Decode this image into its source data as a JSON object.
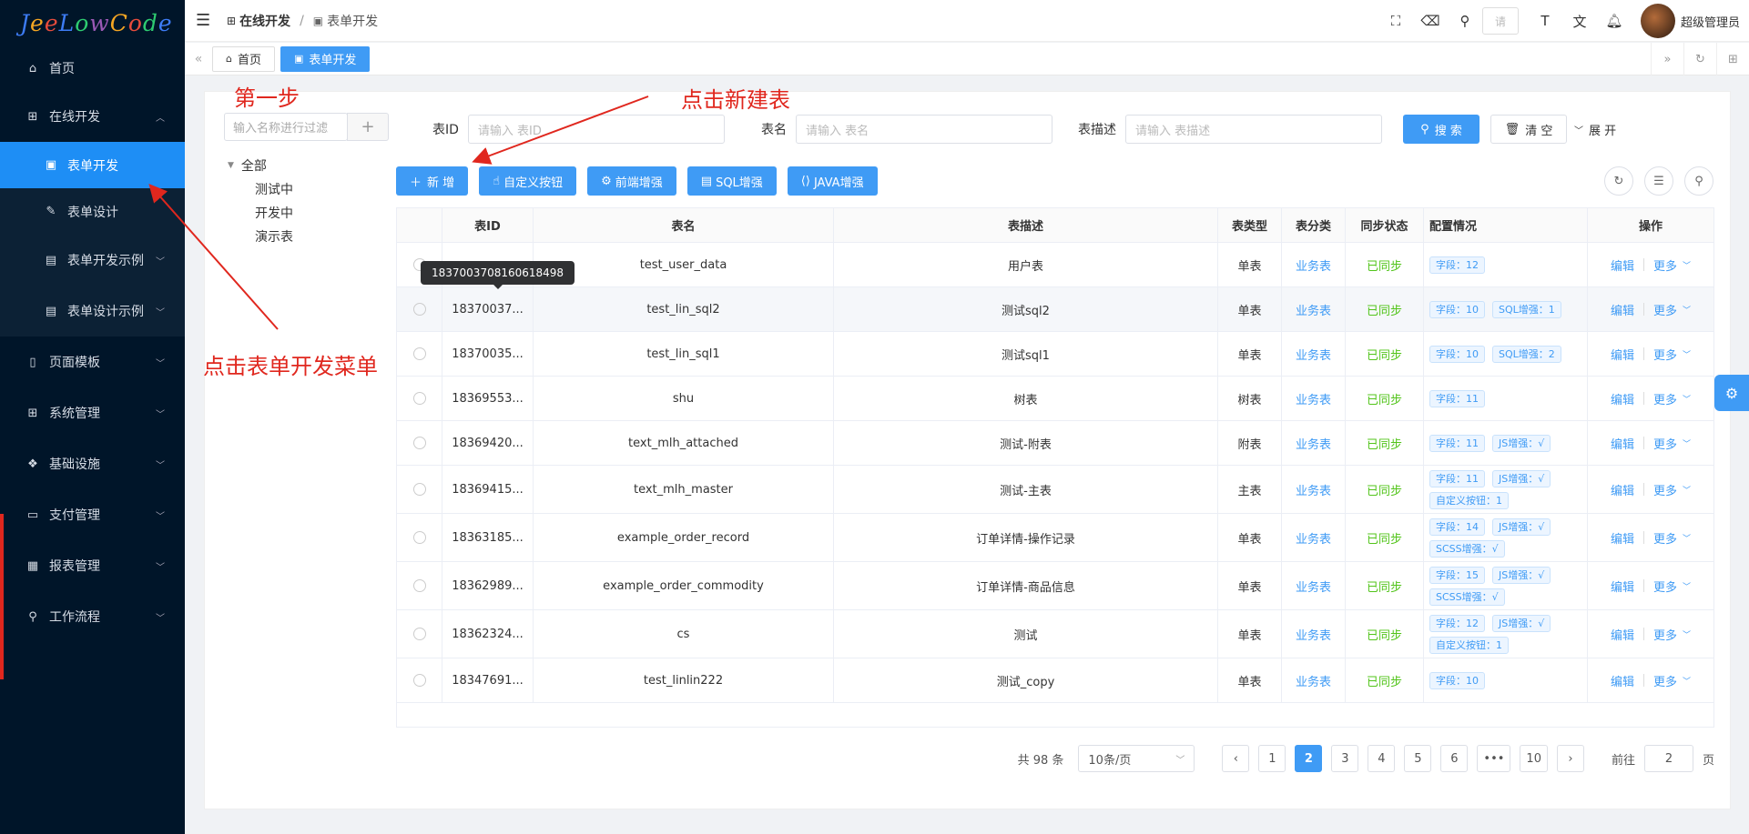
{
  "logo": {
    "text": "JeeLowCode"
  },
  "sidebar": {
    "items": [
      {
        "label": "首页",
        "icon": "home-icon"
      },
      {
        "label": "在线开发",
        "icon": "sitemap-icon",
        "expanded": true
      },
      {
        "label": "页面模板",
        "icon": "tablet-icon"
      },
      {
        "label": "系统管理",
        "icon": "grid-icon"
      },
      {
        "label": "基础设施",
        "icon": "cubes-icon"
      },
      {
        "label": "支付管理",
        "icon": "wallet-icon"
      },
      {
        "label": "报表管理",
        "icon": "report-icon"
      },
      {
        "label": "工作流程",
        "icon": "flow-icon"
      }
    ],
    "sub_items": [
      {
        "label": "表单开发",
        "active": true
      },
      {
        "label": "表单设计"
      },
      {
        "label": "表单开发示例"
      },
      {
        "label": "表单设计示例"
      }
    ]
  },
  "header": {
    "breadcrumb": [
      "在线开发",
      "/",
      "表单开发"
    ],
    "search_placeholder": "请",
    "username": "超级管理员"
  },
  "tabs": [
    {
      "label": "首页"
    },
    {
      "label": "表单开发",
      "active": true
    }
  ],
  "annotations": {
    "step": "第一步",
    "click_new": "点击新建表",
    "click_menu": "点击表单开发菜单"
  },
  "tree": {
    "search_placeholder": "输入名称进行过滤",
    "root": "全部",
    "children": [
      "测试中",
      "开发中",
      "演示表"
    ]
  },
  "filters": {
    "table_id_label": "表ID",
    "table_id_placeholder": "请输入 表ID",
    "table_name_label": "表名",
    "table_name_placeholder": "请输入 表名",
    "table_desc_label": "表描述",
    "table_desc_placeholder": "请输入 表描述",
    "search_btn": "搜 索",
    "clear_btn": "清 空",
    "expand_btn": "展 开"
  },
  "toolbar": {
    "add": "新 增",
    "custom_btn": "自定义按钮",
    "frontend": "前端增强",
    "sql": "SQL增强",
    "java": "JAVA增强"
  },
  "table": {
    "headers": [
      "表ID",
      "表名",
      "表描述",
      "表类型",
      "表分类",
      "同步状态",
      "配置情况",
      "操作"
    ],
    "tooltip": "1837003708160618498",
    "op_edit": "编辑",
    "op_more": "更多",
    "rows": [
      {
        "id": "",
        "name": "test_user_data",
        "desc": "用户表",
        "type": "单表",
        "category": "业务表",
        "sync": "已同步",
        "tags": [
          "字段：12"
        ]
      },
      {
        "id": "18370037...",
        "name": "test_lin_sql2",
        "desc": "测试sql2",
        "type": "单表",
        "category": "业务表",
        "sync": "已同步",
        "tags": [
          "字段：10",
          "SQL增强：1"
        ]
      },
      {
        "id": "18370035...",
        "name": "test_lin_sql1",
        "desc": "测试sql1",
        "type": "单表",
        "category": "业务表",
        "sync": "已同步",
        "tags": [
          "字段：10",
          "SQL增强：2"
        ]
      },
      {
        "id": "18369553...",
        "name": "shu",
        "desc": "树表",
        "type": "树表",
        "category": "业务表",
        "sync": "已同步",
        "tags": [
          "字段：11"
        ]
      },
      {
        "id": "18369420...",
        "name": "text_mlh_attached",
        "desc": "测试-附表",
        "type": "附表",
        "category": "业务表",
        "sync": "已同步",
        "tags": [
          "字段：11",
          "JS增强：√"
        ]
      },
      {
        "id": "18369415...",
        "name": "text_mlh_master",
        "desc": "测试-主表",
        "type": "主表",
        "category": "业务表",
        "sync": "已同步",
        "tags": [
          "字段：11",
          "JS增强：√",
          "自定义按钮：1"
        ]
      },
      {
        "id": "18363185...",
        "name": "example_order_record",
        "desc": "订单详情-操作记录",
        "type": "单表",
        "category": "业务表",
        "sync": "已同步",
        "tags": [
          "字段：14",
          "JS增强：√",
          "SCSS增强：√"
        ]
      },
      {
        "id": "18362989...",
        "name": "example_order_commodity",
        "desc": "订单详情-商品信息",
        "type": "单表",
        "category": "业务表",
        "sync": "已同步",
        "tags": [
          "字段：15",
          "JS增强：√",
          "SCSS增强：√"
        ]
      },
      {
        "id": "18362324...",
        "name": "cs",
        "desc": "测试",
        "type": "单表",
        "category": "业务表",
        "sync": "已同步",
        "tags": [
          "字段：12",
          "JS增强：√",
          "自定义按钮：1"
        ]
      },
      {
        "id": "18347691...",
        "name": "test_linlin222",
        "desc": "测试_copy",
        "type": "单表",
        "category": "业务表",
        "sync": "已同步",
        "tags": [
          "字段：10"
        ]
      }
    ]
  },
  "pager": {
    "total": "共 98 条",
    "page_size": "10条/页",
    "pages": [
      "1",
      "2",
      "3",
      "4",
      "5",
      "6",
      "•••",
      "10"
    ],
    "current": "2",
    "goto_label": "前往",
    "goto_value": "2",
    "page_suffix": "页"
  },
  "colors": {
    "primary": "#3f9bf5",
    "sidebar": "#001529",
    "annotation": "#e0271e",
    "synced": "#52c41a"
  }
}
